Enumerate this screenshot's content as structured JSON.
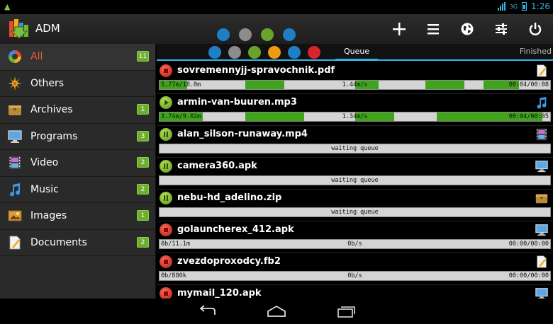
{
  "status_bar": {
    "signal": "3G",
    "time": "1:26"
  },
  "action_bar": {
    "title": "ADM",
    "icons": [
      "plus-icon",
      "menu-list-icon",
      "globe-icon",
      "sliders-icon",
      "power-icon"
    ]
  },
  "sidebar": {
    "items": [
      {
        "label": "All",
        "badge": "11",
        "icon": "all-icon",
        "active": true
      },
      {
        "label": "Others",
        "badge": "",
        "icon": "others-icon"
      },
      {
        "label": "Archives",
        "badge": "1",
        "icon": "archive-icon"
      },
      {
        "label": "Programs",
        "badge": "3",
        "icon": "program-icon"
      },
      {
        "label": "Video",
        "badge": "2",
        "icon": "video-icon"
      },
      {
        "label": "Music",
        "badge": "2",
        "icon": "music-icon"
      },
      {
        "label": "Images",
        "badge": "1",
        "icon": "image-icon"
      },
      {
        "label": "Documents",
        "badge": "2",
        "icon": "document-icon"
      }
    ]
  },
  "tabs": {
    "queue": "Queue",
    "finished": "Finished"
  },
  "dot_colors": [
    "#1f7fc4",
    "#8c8c8c",
    "#6aa32c",
    "#f09a12",
    "#1f7fc4",
    "#d8242a"
  ],
  "downloads": [
    {
      "name": "sovremennyjj-spravochnik.pdf",
      "state": "stop",
      "icon": "document-icon",
      "left": "5.77m/18.0m",
      "center": "1.44m/s",
      "right": "00:04/00:08",
      "progress": [
        [
          0,
          0.07
        ],
        [
          0.22,
          0.32
        ],
        [
          0.5,
          0.56
        ],
        [
          0.68,
          0.78
        ],
        [
          0.83,
          0.92
        ]
      ]
    },
    {
      "name": "armin-van-buuren.mp3",
      "state": "play",
      "icon": "music-icon",
      "left": "3.74m/9.02m",
      "center": "1.34m/s",
      "right": "00:04/00:05",
      "progress": [
        [
          0,
          0.11
        ],
        [
          0.22,
          0.37
        ],
        [
          0.5,
          0.6
        ],
        [
          0.71,
          0.98
        ]
      ]
    },
    {
      "name": "alan_silson-runaway.mp4",
      "state": "pause",
      "icon": "video-icon",
      "left": "",
      "center": "waiting queue",
      "right": "",
      "progress": []
    },
    {
      "name": "camera360.apk",
      "state": "pause",
      "icon": "program-icon",
      "left": "",
      "center": "waiting queue",
      "right": "",
      "progress": []
    },
    {
      "name": "nebu-hd_adelino.zip",
      "state": "pause",
      "icon": "archive-icon",
      "left": "",
      "center": "waiting queue",
      "right": "",
      "progress": []
    },
    {
      "name": "golauncherex_412.apk",
      "state": "stop",
      "icon": "program-icon",
      "left": "0b/11.1m",
      "center": "0b/s",
      "right": "00:00/00:00",
      "progress": []
    },
    {
      "name": "zvezdoproxodcy.fb2",
      "state": "stop",
      "icon": "document-icon",
      "left": "0b/880k",
      "center": "0b/s",
      "right": "00:00/00:00",
      "progress": []
    },
    {
      "name": "mymail_120.apk",
      "state": "stop",
      "icon": "program-icon",
      "left": "",
      "center": "",
      "right": "",
      "progress": []
    }
  ],
  "nav_bar": {
    "icons": [
      "back-icon",
      "home-icon",
      "recent-apps-icon"
    ]
  }
}
